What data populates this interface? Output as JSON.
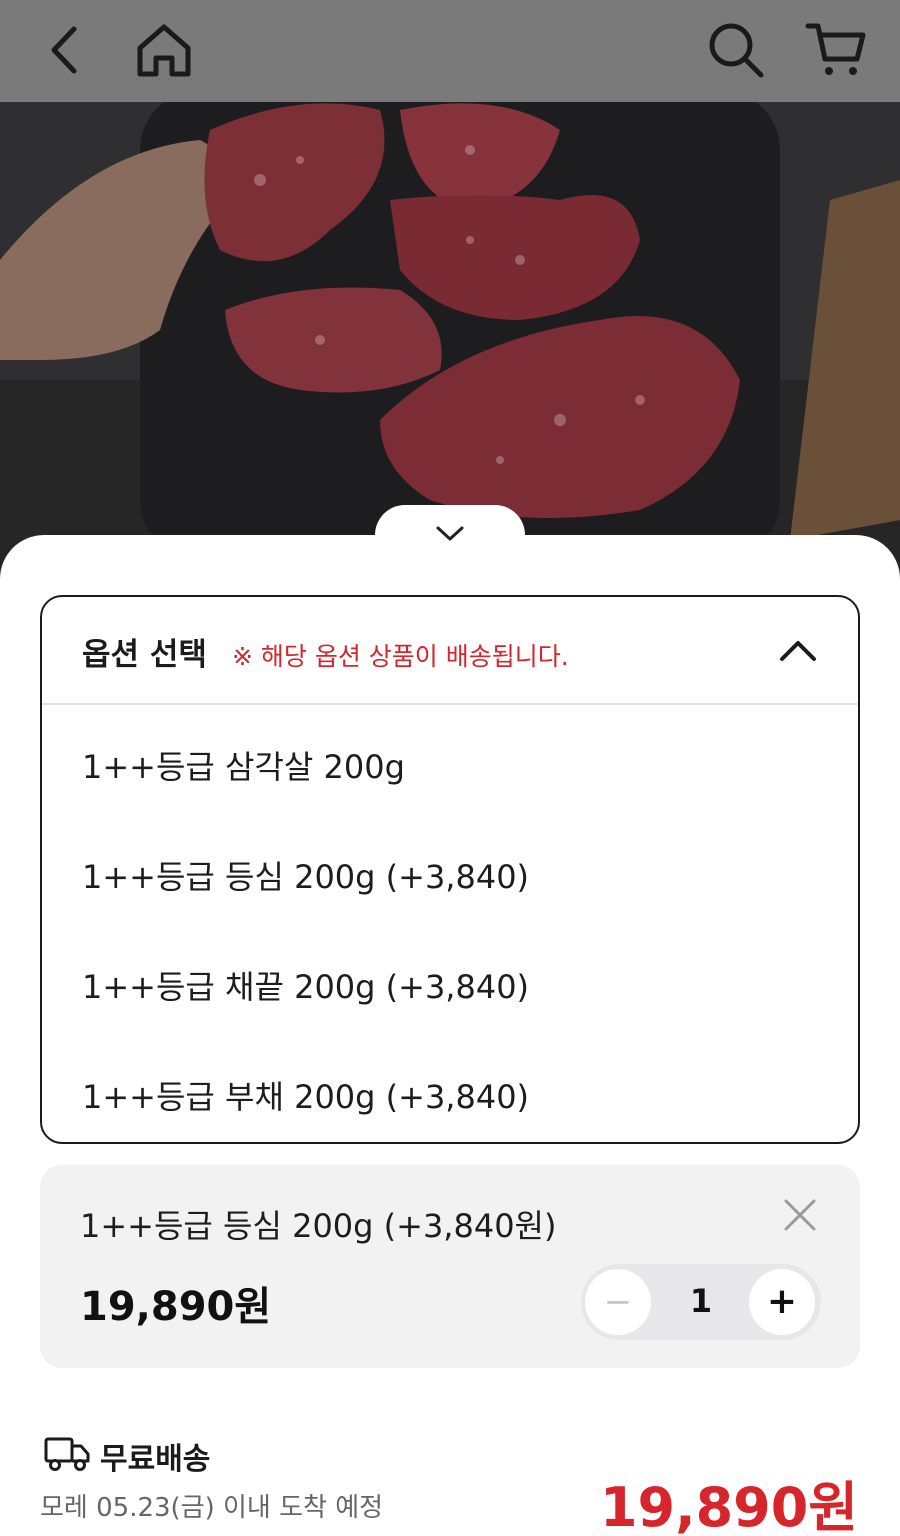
{
  "header": {
    "icons": [
      "back-icon",
      "home-icon",
      "search-icon",
      "cart-icon"
    ]
  },
  "options": {
    "title": "옵션 선택",
    "notice": "※ 해당 옵션 상품이 배송됩니다.",
    "items": [
      "1++등급 삼각살 200g",
      "1++등급 등심 200g (+3,840)",
      "1++등급 채끝 200g (+3,840)",
      "1++등급 부채 200g (+3,840)"
    ]
  },
  "selected": {
    "name": "1++등급 등심 200g (+3,840원)",
    "price": "19,890원",
    "minus": "−",
    "quantity": "1",
    "plus": "+"
  },
  "shipping": {
    "label": "무료배송",
    "eta": "모레 05.23(금) 이내 도착 예정"
  },
  "total": "19,890원",
  "colors": {
    "accent": "#d6262b",
    "overlay": "#7a7a7a"
  }
}
